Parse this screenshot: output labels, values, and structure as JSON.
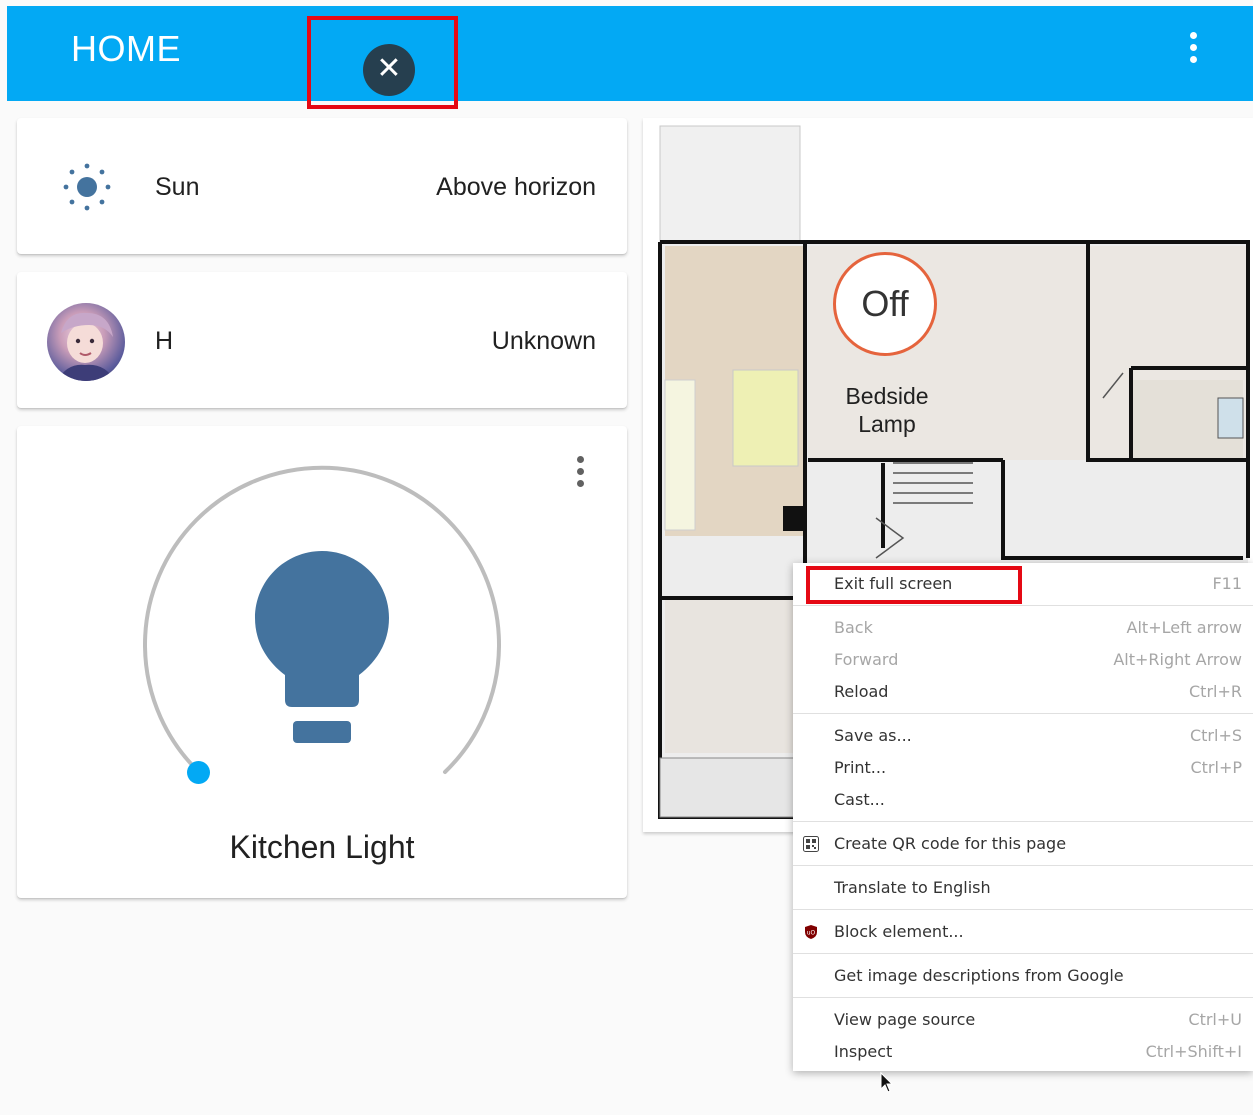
{
  "header": {
    "title": "HOME",
    "close_icon": "close-icon",
    "menu_icon": "vertical-dots-icon"
  },
  "entities": [
    {
      "icon": "sun-icon",
      "name": "Sun",
      "state": "Above horizon"
    },
    {
      "icon": "avatar",
      "name": "H",
      "state": "Unknown"
    }
  ],
  "light_card": {
    "name": "Kitchen Light",
    "icon": "lightbulb-icon",
    "brightness_fraction": 0.0,
    "colors": {
      "bulb": "#44739e",
      "slider_dot": "#03a9f4",
      "track": "#bdbdbd"
    }
  },
  "floorplan": {
    "state": "Off",
    "label": "Bedside Lamp"
  },
  "context_menu": {
    "items": [
      {
        "label": "Exit full screen",
        "shortcut": "F11"
      },
      {
        "label": "Back",
        "shortcut": "Alt+Left arrow"
      },
      {
        "label": "Forward",
        "shortcut": "Alt+Right Arrow"
      },
      {
        "label": "Reload",
        "shortcut": "Ctrl+R"
      },
      {
        "label": "Save as...",
        "shortcut": "Ctrl+S"
      },
      {
        "label": "Print...",
        "shortcut": "Ctrl+P"
      },
      {
        "label": "Cast...",
        "shortcut": ""
      },
      {
        "label": "Create QR code for this page",
        "shortcut": "",
        "icon": "qr-code-icon"
      },
      {
        "label": "Translate to English",
        "shortcut": ""
      },
      {
        "label": "Block element...",
        "shortcut": "",
        "icon": "ublock-shield-icon"
      },
      {
        "label": "Get image descriptions from Google",
        "shortcut": ""
      },
      {
        "label": "View page source",
        "shortcut": "Ctrl+U"
      },
      {
        "label": "Inspect",
        "shortcut": "Ctrl+Shift+I"
      }
    ]
  },
  "colors": {
    "header": "#03a9f4",
    "highlight_box": "#e50914",
    "off_ring": "#e5643d"
  }
}
